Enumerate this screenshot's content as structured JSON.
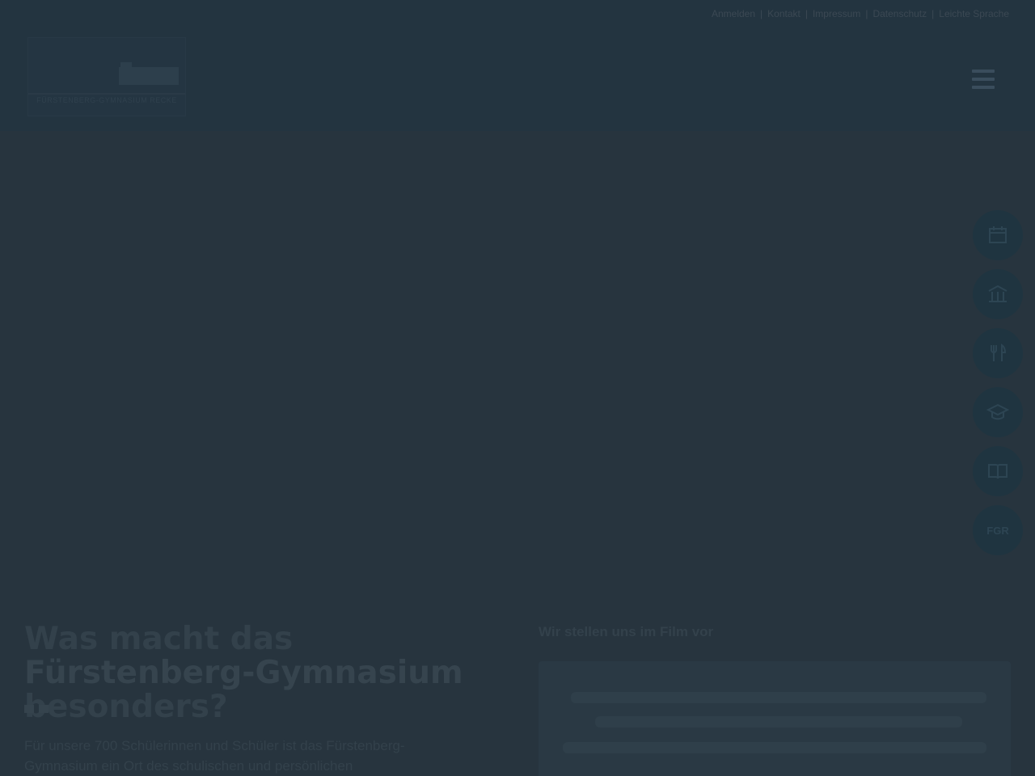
{
  "meta_bar": {
    "links": [
      "Anmelden",
      "Kontakt",
      "Impressum",
      "Datenschutz",
      "Leichte Sprache"
    ]
  },
  "logo": {
    "alt": "Fürstenberg-Gymnasium Recke",
    "tagline": "FÜRSTENBERG-GYMNASIUM RECKE"
  },
  "nav": {
    "menu_label": "Menü"
  },
  "side_actions": [
    {
      "icon": "calendar-icon",
      "label": "Termine"
    },
    {
      "icon": "school-building-icon",
      "label": "Schule"
    },
    {
      "icon": "cutlery-icon",
      "label": "Mensa"
    },
    {
      "icon": "graduation-cap-icon",
      "label": "Oberstufe"
    },
    {
      "icon": "book-icon",
      "label": "Bibliothek"
    },
    {
      "icon": "text-badge-icon",
      "label": "FGR"
    }
  ],
  "intro": {
    "title_pre": "Was macht das ",
    "title_bold": "Fürstenberg-Gymnasium",
    "title_post": " besonders?",
    "text": "Für unsere 700 Schülerinnen und Schüler ist das Fürstenberg-Gymnasium ein Ort des schulischen und persönlichen"
  },
  "video": {
    "label": "Wir stellen uns im Film vor"
  }
}
